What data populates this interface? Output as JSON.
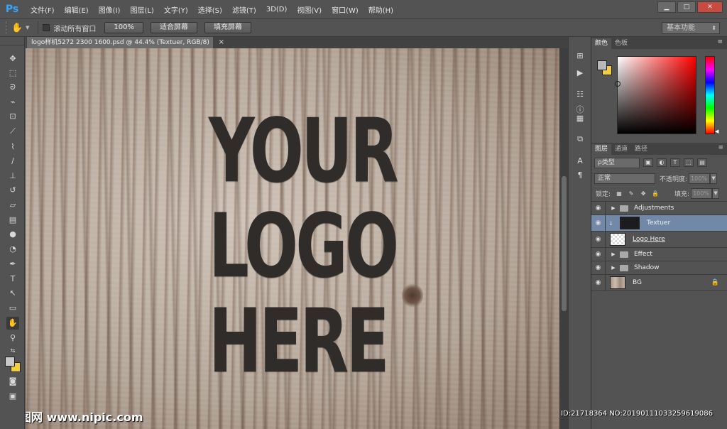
{
  "app": {
    "logo": "Ps",
    "accent": "#30a8ff"
  },
  "menu": [
    "文件(F)",
    "编辑(E)",
    "图像(I)",
    "图层(L)",
    "文字(Y)",
    "选择(S)",
    "滤镜(T)",
    "3D(D)",
    "视图(V)",
    "窗口(W)",
    "帮助(H)"
  ],
  "window_controls": {
    "minimize": "▁",
    "maximize": "□",
    "close": "✕"
  },
  "options": {
    "scroll_all_label": "滚动所有窗口",
    "zoom_100": "100%",
    "fit_screen": "适合屏幕",
    "fill_screen": "填充屏幕",
    "workspace": "基本功能"
  },
  "document": {
    "tab_title": "logo样机5272 2300 1600.psd @ 44.4% (Textuer, RGB/8)",
    "close": "×",
    "canvas_lines": [
      "YOUR",
      "LOGO",
      "HERE"
    ]
  },
  "color_panel": {
    "tabs": [
      "颜色",
      "色板"
    ],
    "fg_color": "#b8b8b8",
    "bg_color": "#f1cd3c"
  },
  "layers_panel": {
    "tabs": [
      "图层",
      "通道",
      "路径"
    ],
    "kind_filter": "ρ类型",
    "blend_mode": "正常",
    "opacity_label": "不透明度:",
    "opacity_value": "100%",
    "lock_label": "锁定:",
    "fill_label": "填充:",
    "fill_value": "100%",
    "layers": [
      {
        "name": "Adjustments",
        "type": "group"
      },
      {
        "name": "Textuer",
        "type": "smart",
        "selected": true
      },
      {
        "name": "Logo Here",
        "type": "layer"
      },
      {
        "name": "Effect",
        "type": "group"
      },
      {
        "name": "Shadow",
        "type": "group"
      },
      {
        "name": "BG",
        "type": "background",
        "locked": true
      }
    ]
  },
  "watermark": {
    "left": "昵图网 www.nipic.com",
    "right": "ID:21718364 NO:20190111033259619086"
  }
}
